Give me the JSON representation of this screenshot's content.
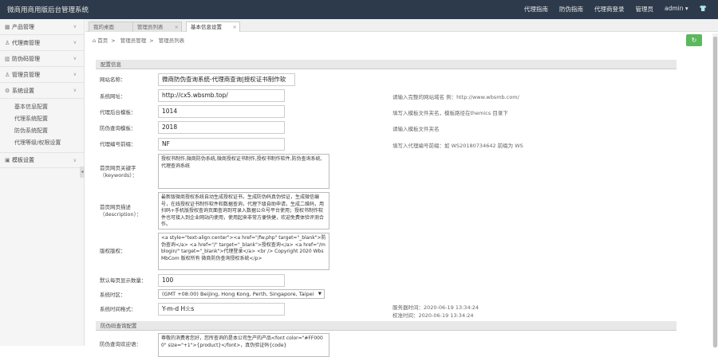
{
  "app_title": "微商用商用版后台管理系统",
  "topnav": [
    "代理指南",
    "防伪指南",
    "代理商登录",
    "管理员",
    "admin ▾"
  ],
  "sidebar": {
    "groups": [
      {
        "label": "产品管理",
        "icon": "grid-icon"
      },
      {
        "label": "代理商管理",
        "icon": "user-icon"
      },
      {
        "label": "防伪码管理",
        "icon": "barcode-icon"
      },
      {
        "label": "管理员管理",
        "icon": "user-icon"
      },
      {
        "label": "系统设置",
        "icon": "cog-icon",
        "expanded": true,
        "items": [
          "基本信息配置",
          "代理系统配置",
          "防伪系统配置",
          "代理等级/权限设置"
        ]
      },
      {
        "label": "模板设置",
        "icon": "template-icon"
      }
    ]
  },
  "tabs": [
    {
      "label": "我的桌面",
      "active": false
    },
    {
      "label": "管理员列表",
      "active": false
    },
    {
      "label": "基本信息设置",
      "active": true
    }
  ],
  "breadcrumb": [
    "⌂ 首页",
    "管理员管理",
    "管理员列表"
  ],
  "sections": {
    "basic": "配置信息",
    "anti": "防伪码查询配置"
  },
  "form": {
    "site_name": {
      "label": "网站名称：",
      "value": "微商防伪查询系统-代理商查询|授权证书制作软"
    },
    "site_url": {
      "label": "系统网址：",
      "value": "http://cx5.wbsmb.top/",
      "hint": "请输入完整的网站域名 例：http://www.wbsmb.com/"
    },
    "template_dir": {
      "label": "代理后台模板：",
      "value": "1014",
      "hint": "填写入模板文件夹名，模板路径在themics 目录下"
    },
    "anti_template": {
      "label": "防伪查询模板：",
      "value": "2018",
      "hint": "请输入模板文件夹名"
    },
    "agent_prefix": {
      "label": "代理编号前缀：",
      "value": "NF",
      "hint": "填写入代理编号前缀：如 WS20180734642 前缀为 WS"
    },
    "keywords": {
      "label": "首页网页关键字（keywords）：",
      "value": "授权书制作,微商防伪系统,微商授权证书制作,授权书制作软件,防伪查询系统,代理查询系统"
    },
    "description": {
      "label": "首页网页描述（description）：",
      "value": "最新版微商授权系统自动生成授权证书，生成防伪码真伪验证，生成微信编号，在线授权证书制作软件和数据查询，代理下级自助申请，生成二维码，用扫码+手机版授权查询页面查询到可录入数据公众号平台使用；授权书制作软件也可接入到企业网站内使用，使用起来非常方便快捷，欢迎免费体验评测合作。"
    },
    "copyright": {
      "label": "版权版权：",
      "value": "<a style=\"text-align:center\"><a href=\"/fw.php\" target=\"_blank\">防伪查询</a>    <a href=\"/\" target=\"_blank\">授权查询</a>    <a href=\"/mblogin/\" target=\"_blank\">代理登录</a> <br /> Copyright 2020  WbsMbCom  版权所有  微商防伪查询授权系统</p>"
    },
    "page_size": {
      "label": "默认每页显示数量：",
      "value": "100"
    },
    "timezone": {
      "label": "系统时区：",
      "value": "(GMT +08:00) Beijing, Hong Kong, Perth, Singapore, Taipei"
    },
    "time_format": {
      "label": "系统时间格式：",
      "value": "Y-m-d H:i:s",
      "server_time": "服务器时间：2020-06-19 13:34:24",
      "correct_time": "校准时间：2020-06-19 13:34:24"
    },
    "anti_welcome": {
      "label": "防伪查询欢迎语：",
      "value": "尊敬的消费者您好，您所查询的是本公司生产的产品<font color=\"#FF0000\" size=\"+1\">{product}</font>，真伪验证码{code}"
    }
  },
  "colors": {
    "topbar": "#2d3a4b",
    "refresh": "#5cb85c"
  }
}
